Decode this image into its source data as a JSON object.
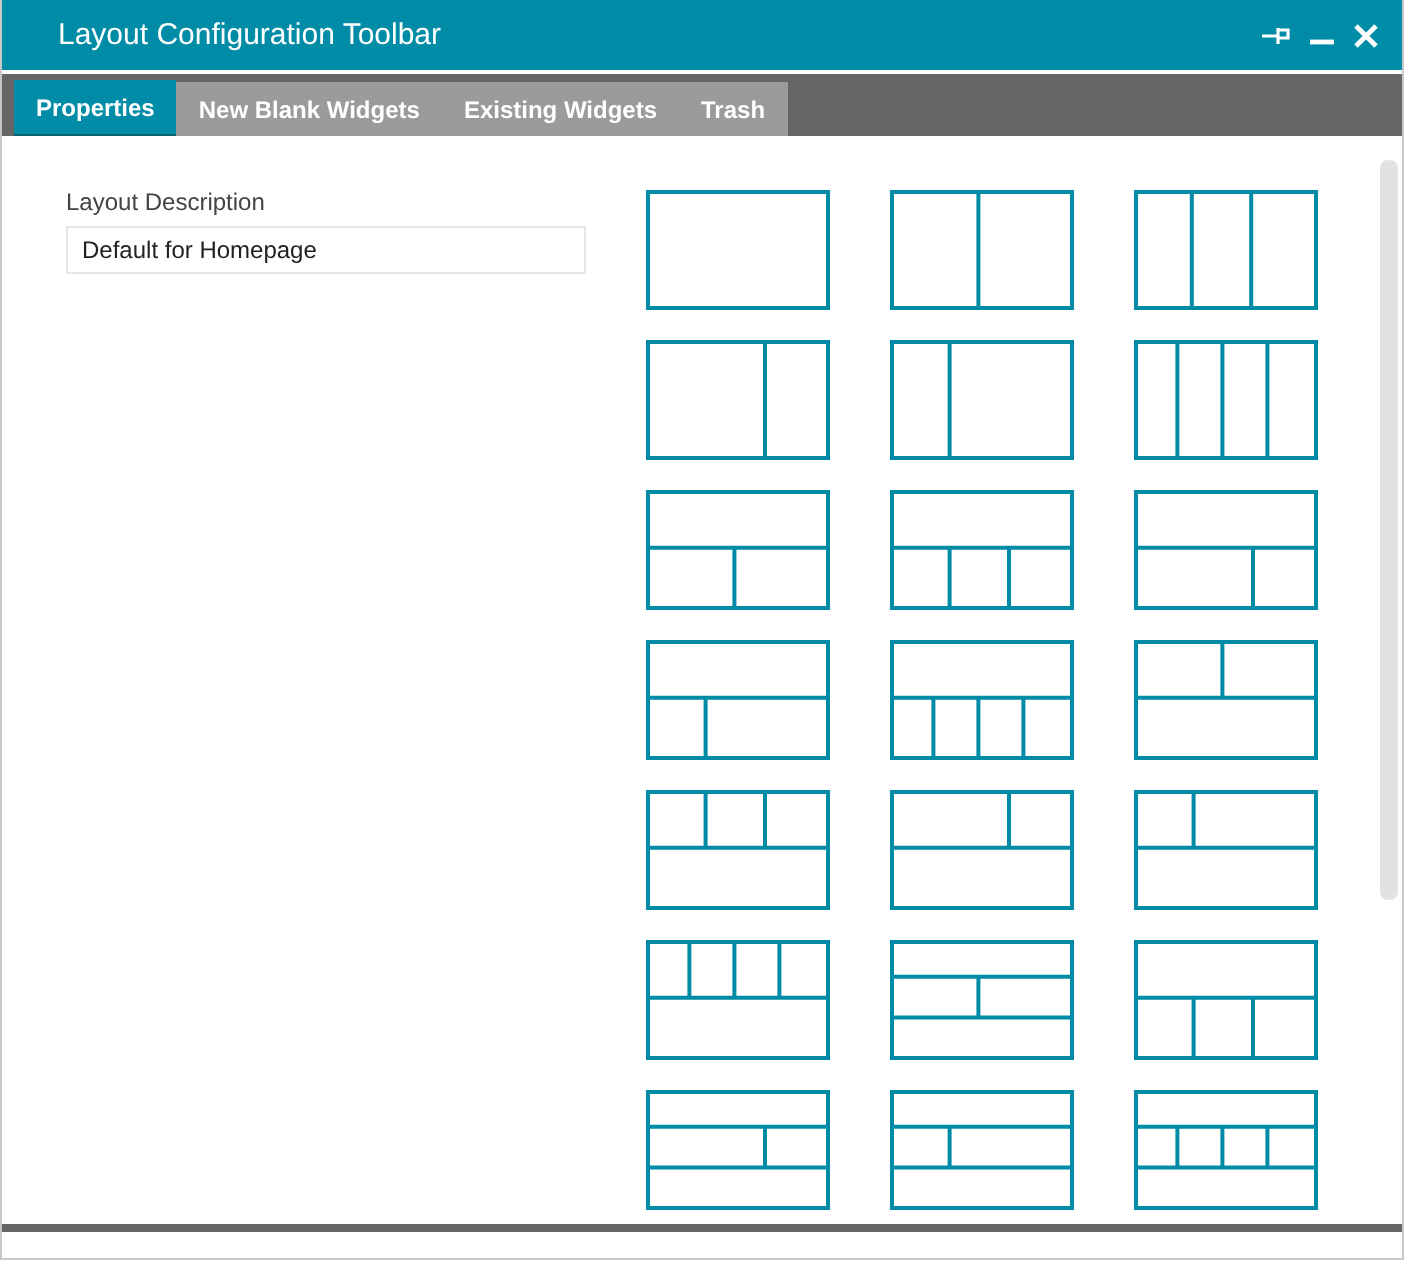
{
  "window": {
    "title": "Layout Configuration Toolbar"
  },
  "tabs": [
    {
      "label": "Properties",
      "selected": true
    },
    {
      "label": "New Blank Widgets",
      "selected": false
    },
    {
      "label": "Existing Widgets",
      "selected": false
    },
    {
      "label": "Trash",
      "selected": false
    }
  ],
  "layout_description": {
    "label": "Layout Description",
    "value": "Default for Homepage"
  }
}
